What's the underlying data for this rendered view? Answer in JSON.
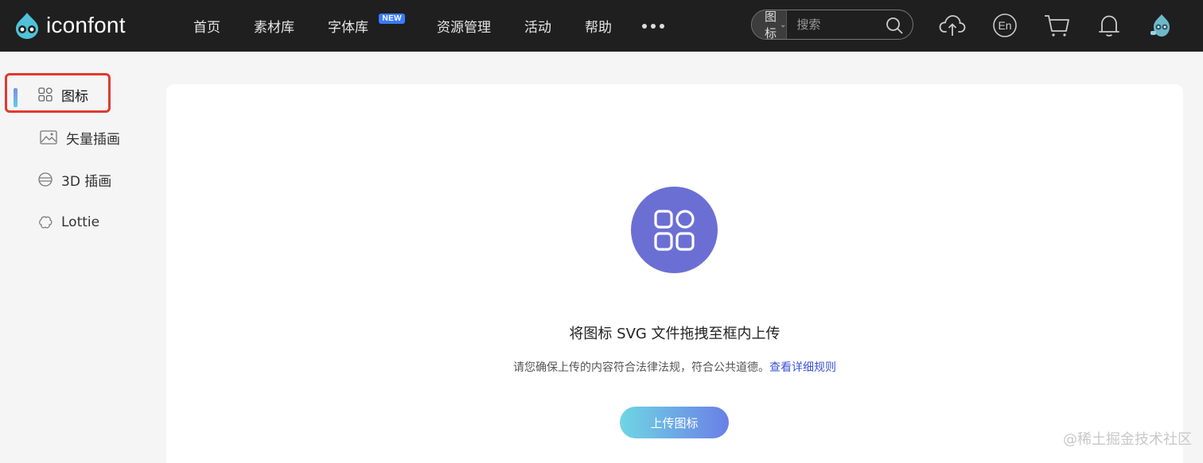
{
  "header": {
    "logo_text": "iconfont",
    "nav": [
      {
        "label": "首页"
      },
      {
        "label": "素材库"
      },
      {
        "label": "字体库",
        "badge": "NEW"
      },
      {
        "label": "资源管理"
      },
      {
        "label": "活动"
      },
      {
        "label": "帮助"
      }
    ],
    "more_icon": "more-dots-icon",
    "search": {
      "type_label": "图标",
      "placeholder": "搜索"
    },
    "icons": [
      "cloud-upload-icon",
      "language-en-icon",
      "cart-icon",
      "bell-icon",
      "avatar"
    ],
    "language_label": "En"
  },
  "sidebar": {
    "items": [
      {
        "label": "图标",
        "icon": "grid-icon",
        "active": true
      },
      {
        "label": "矢量插画",
        "icon": "image-icon"
      },
      {
        "label": "3D 插画",
        "icon": "sphere-icon"
      },
      {
        "label": "Lottie",
        "icon": "lottie-icon"
      }
    ]
  },
  "upload": {
    "title": "将图标 SVG 文件拖拽至框内上传",
    "notice": "请您确保上传的内容符合法律法规，符合公共道德。",
    "rules_link": "查看详细规则",
    "button_label": "上传图标"
  },
  "watermark": "@稀土掘金技术社区",
  "colors": {
    "accent": "#6b6fd4",
    "highlight": "#e03a30",
    "link": "#3b54d8",
    "topbar": "#1f1f1f"
  }
}
